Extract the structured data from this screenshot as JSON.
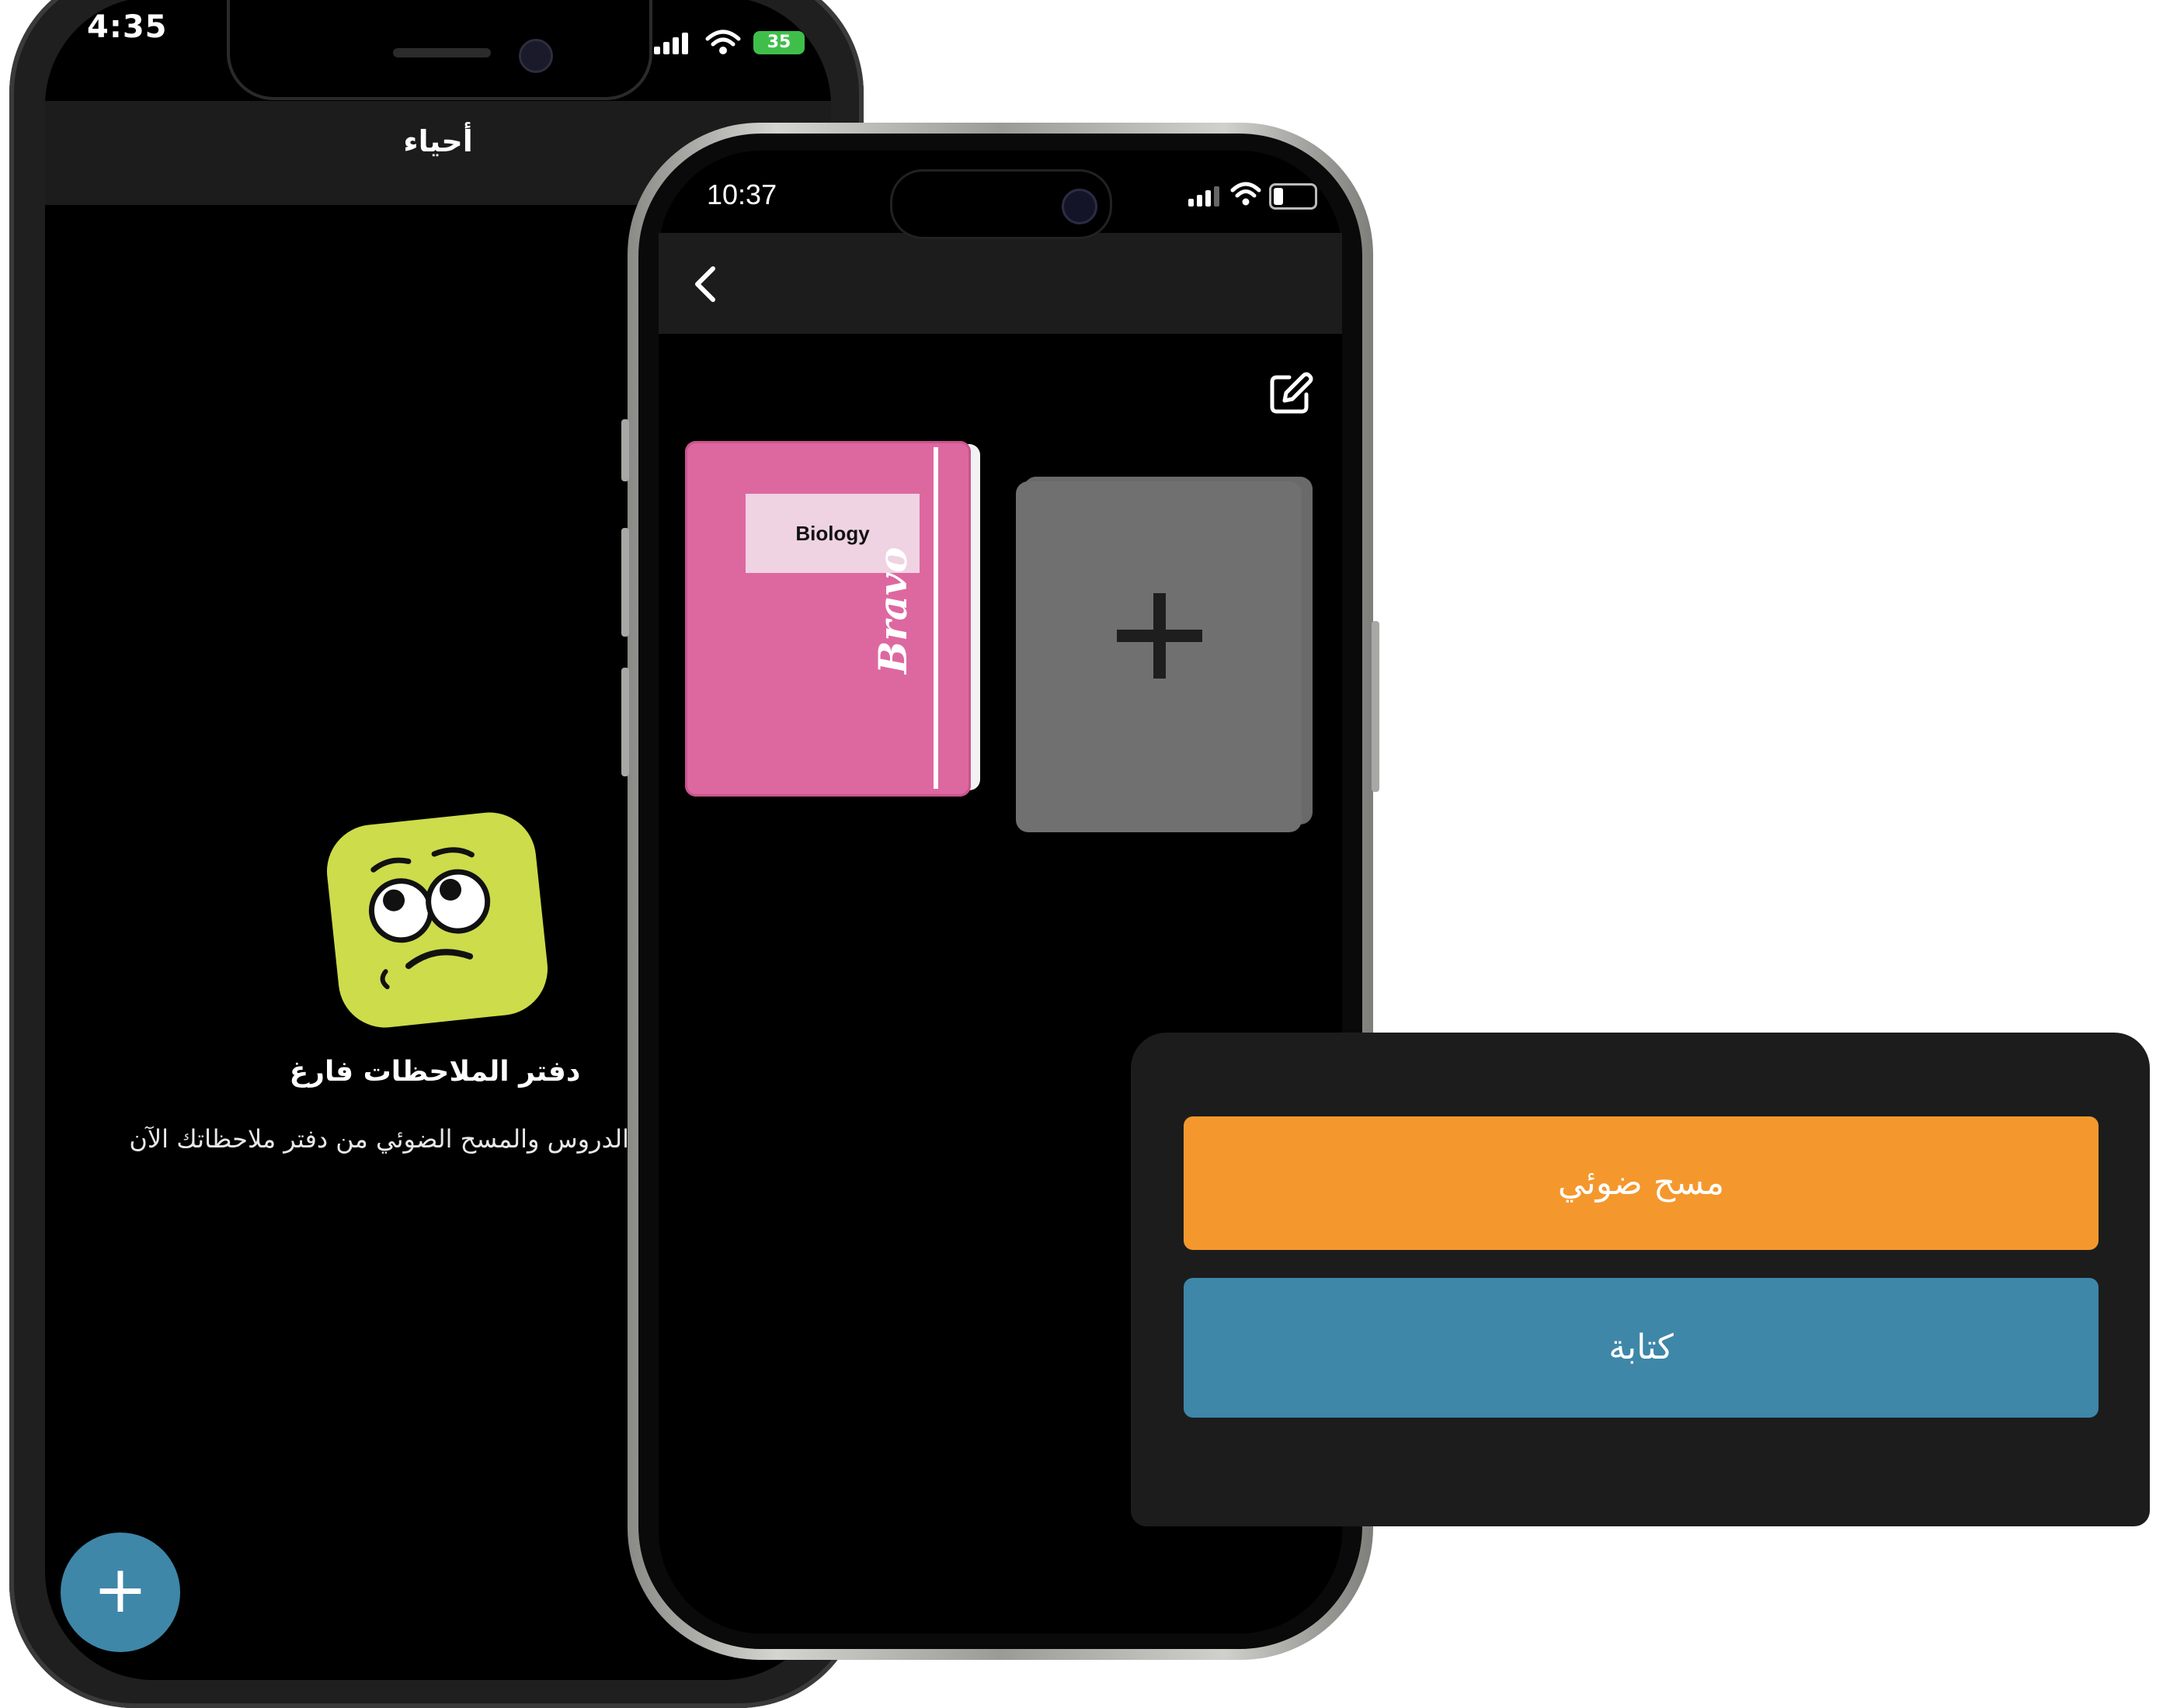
{
  "phone_left": {
    "status_time": "4:35",
    "battery_label": "35",
    "header_title": "أحياء",
    "empty_title": "دفتر الملاحظات فارغ",
    "empty_subtitle": "الدروس والمسح الضوئي من دفتر ملاحظاتك الآن",
    "fab_label": "+",
    "colors": {
      "fab": "#3e87a8",
      "mascot": "#cddc4a",
      "battery": "#3fbf4a"
    }
  },
  "phone_right": {
    "status_time": "10:37",
    "notebooks": [
      {
        "label": "Biology",
        "brand": "Bravo",
        "color": "#dd68a0"
      }
    ],
    "add_notebook_label": "+",
    "icons": {
      "back": "chevron-left-icon",
      "edit": "edit-icon"
    }
  },
  "action_sheet": {
    "scan_label": "مسح ضوئي",
    "write_label": "كتابة",
    "colors": {
      "scan": "#f4982d",
      "write": "#3e87a8",
      "sheet": "#1c1c1c"
    }
  }
}
